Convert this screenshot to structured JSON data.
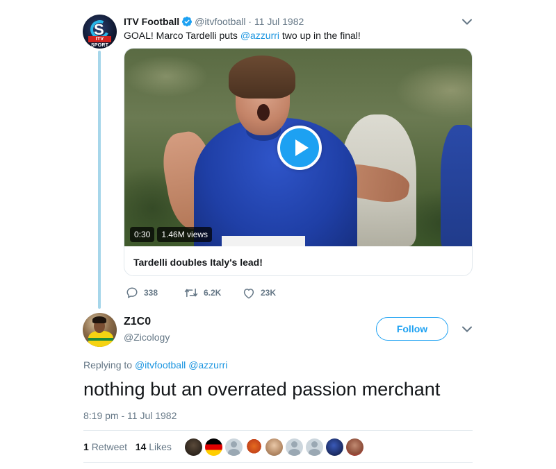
{
  "parent_tweet": {
    "author_name": "ITV Football",
    "handle": "@itvfootball",
    "separator": "·",
    "date": "11 Jul 1982",
    "avatar_badge": "ITV SPORT",
    "text_before": "GOAL! Marco Tardelli puts ",
    "mention": "@azzurri",
    "text_after": " two up in the final!",
    "video": {
      "duration": "0:30",
      "views": "1.46M views",
      "title": "Tardelli doubles Italy's lead!"
    },
    "actions": {
      "replies": "338",
      "retweets": "6.2K",
      "likes": "23K"
    }
  },
  "reply_tweet": {
    "author_name": "Z1C0",
    "handle": "@Zicology",
    "follow_label": "Follow",
    "replying_prefix": "Replying to ",
    "replying_to": [
      "@itvfootball",
      "@azzurri"
    ],
    "text": "nothing but an overrated passion merchant",
    "timestamp": "8:19 pm - 11 Jul 1982",
    "retweet_count": "1",
    "retweet_label": "Retweet",
    "like_count": "14",
    "like_label": "Likes",
    "likers": [
      "liker-1",
      "liker-2-flag",
      "liker-3",
      "liker-4",
      "liker-5",
      "liker-6",
      "liker-7",
      "liker-8",
      "liker-9"
    ]
  },
  "colors": {
    "accent": "#1da1f2",
    "link": "#1b95e0",
    "muted": "#657786",
    "thread_line": "#a6d6ea"
  }
}
